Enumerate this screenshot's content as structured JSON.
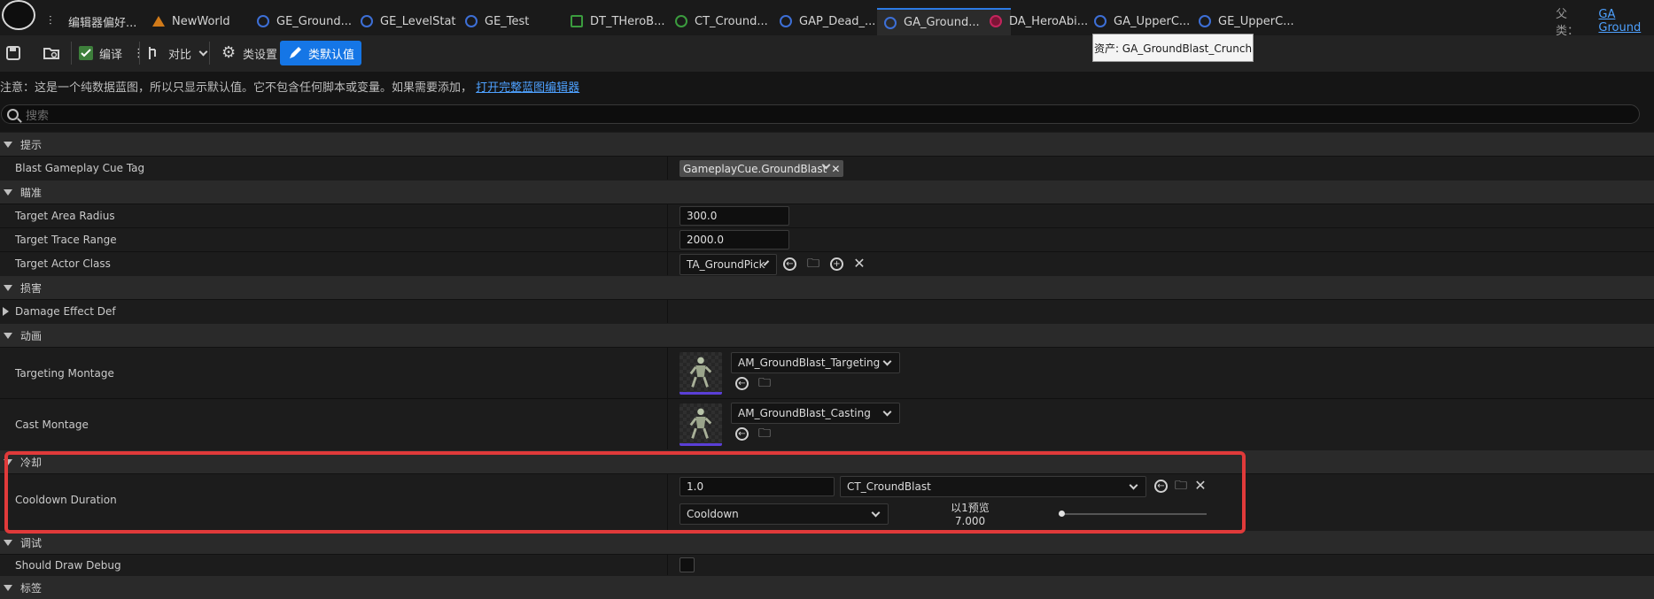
{
  "tabs": [
    {
      "label": "编辑器偏好...",
      "icon": "settings-sliders-icon"
    },
    {
      "label": "NewWorld",
      "icon": "world-map-icon"
    },
    {
      "label": "GE_Ground...",
      "icon": "gameplay-effect-icon"
    },
    {
      "label": "GE_LevelStat",
      "icon": "gameplay-effect-icon"
    },
    {
      "label": "GE_Test",
      "icon": "gameplay-effect-icon"
    },
    {
      "label": "DT_THeroB...",
      "icon": "data-table-icon"
    },
    {
      "label": "CT_Cround...",
      "icon": "curve-table-icon"
    },
    {
      "label": "GAP_Dead_...",
      "icon": "gameplay-ability-icon"
    },
    {
      "label": "GA_Ground...",
      "icon": "gameplay-ability-icon",
      "active": true
    },
    {
      "label": "DA_HeroAbi...",
      "icon": "data-asset-icon"
    },
    {
      "label": "GA_UpperC...",
      "icon": "gameplay-ability-icon"
    },
    {
      "label": "GE_UpperC...",
      "icon": "gameplay-effect-icon"
    }
  ],
  "parent": {
    "label": "父类：",
    "value": "GA Ground"
  },
  "toolbar": {
    "compile_label": "编译",
    "diff_label": "对比",
    "class_settings_label": "类设置",
    "class_defaults_label": "类默认值"
  },
  "tooltip": "资产: GA_GroundBlast_Crunch",
  "notice": {
    "text": "注意：这是一个纯数据蓝图，所以只显示默认值。它不包含任何脚本或变量。如果需要添加，",
    "link": "打开完整蓝图编辑器"
  },
  "search": {
    "placeholder": "搜索"
  },
  "categories": {
    "hint": "提示",
    "aim": "瞄准",
    "damage": "损害",
    "animation": "动画",
    "cooldown": "冷却",
    "debug": "调试",
    "tags": "标签"
  },
  "props": {
    "blast_cue_tag": {
      "label": "Blast Gameplay Cue Tag",
      "value": "GameplayCue.GroundBlast"
    },
    "target_area_radius": {
      "label": "Target Area Radius",
      "value": "300.0"
    },
    "target_trace_range": {
      "label": "Target Trace Range",
      "value": "2000.0"
    },
    "target_actor_class": {
      "label": "Target Actor Class",
      "value": "TA_GroundPick"
    },
    "damage_effect_def": {
      "label": "Damage Effect Def"
    },
    "targeting_montage": {
      "label": "Targeting Montage",
      "value": "AM_GroundBlast_Targeting"
    },
    "cast_montage": {
      "label": "Cast Montage",
      "value": "AM_GroundBlast_Casting"
    },
    "cooldown_duration": {
      "label": "Cooldown Duration",
      "value": "1.0",
      "curve_table": "CT_CroundBlast",
      "row_name": "Cooldown",
      "preview_label": "以1预览",
      "preview_value": "7.000",
      "preview_level": 0
    },
    "should_draw_debug": {
      "label": "Should Draw Debug",
      "checked": false
    }
  },
  "colors": {
    "accent": "#1576e6",
    "highlight": "#e03a3a",
    "link": "#4ea1ff"
  }
}
